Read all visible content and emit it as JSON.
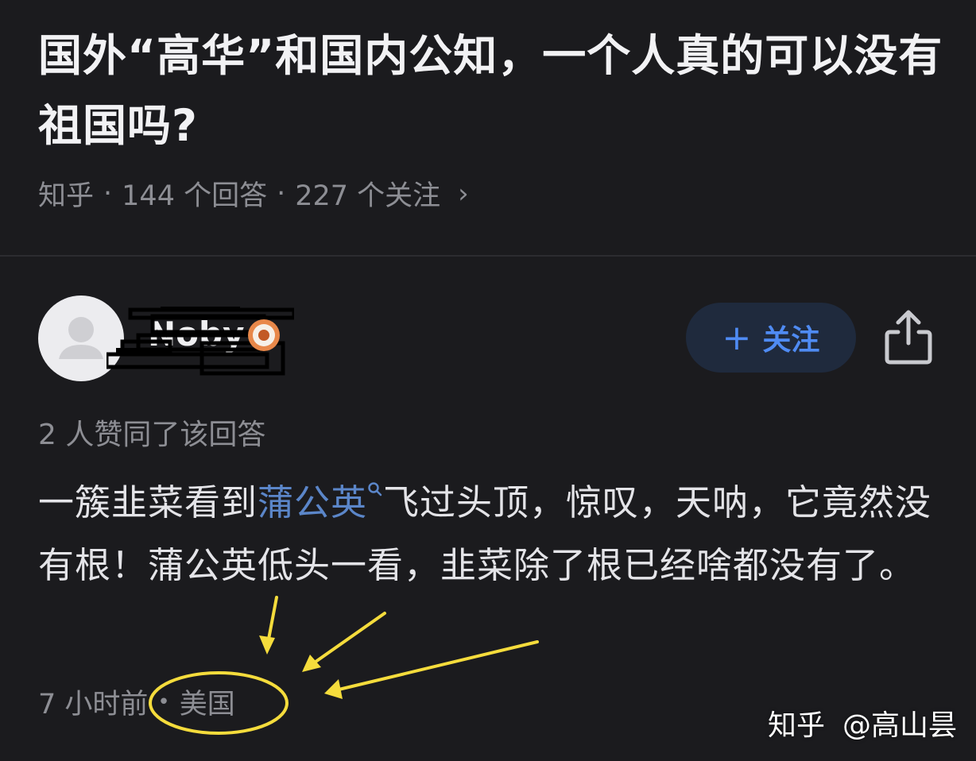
{
  "question": {
    "title": "国外“高华”和国内公知，一个人真的可以没有祖国吗?",
    "platform": "知乎",
    "answers": "144 个回答",
    "follows": "227 个关注",
    "separator": "·",
    "chevron": "›"
  },
  "author": {
    "name": "Noby",
    "avatar_icon": "default-avatar-icon",
    "badge_icon": "badge-icon"
  },
  "follow_button": {
    "plus": "+",
    "label": "关注",
    "color": "#4f8bf3"
  },
  "share_icon": "share-icon",
  "answer": {
    "likes": "2 人赞同了该回答",
    "text_before": "一簇韭菜看到",
    "link_word": "蒲公英",
    "text_after": "飞过头顶，惊叹，天呐，它竟然没有根！蒲公英低头一看，韭菜除了根已经啥都没有了。",
    "time": "7 小时前",
    "dot": "•",
    "location": "美国"
  },
  "annotation": {
    "color": "#f5dc3c",
    "arrow_count": 3
  },
  "watermark": {
    "logo": "知乎",
    "user": "@高山昙"
  }
}
